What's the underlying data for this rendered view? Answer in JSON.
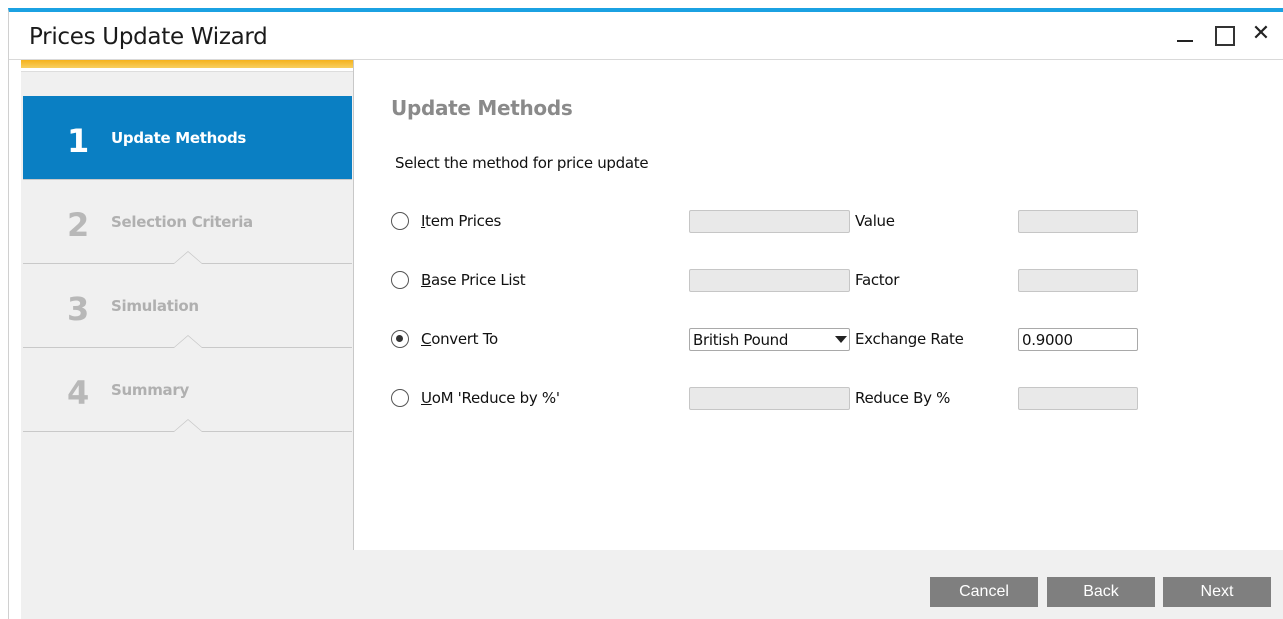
{
  "window": {
    "title": "Prices Update Wizard",
    "accent_color": "#1ba1e2"
  },
  "sidebar": {
    "steps": [
      {
        "number": "1",
        "label": "Update Methods",
        "active": true
      },
      {
        "number": "2",
        "label": "Selection Criteria",
        "active": false
      },
      {
        "number": "3",
        "label": "Simulation",
        "active": false
      },
      {
        "number": "4",
        "label": "Summary",
        "active": false
      }
    ],
    "active_color": "#0a7fc3"
  },
  "main": {
    "section_title": "Update Methods",
    "instruction": "Select the method for price update",
    "methods": [
      {
        "label_first": "I",
        "label_rest": "tem Prices",
        "selected": false,
        "field_value": "",
        "param_label": "Value",
        "param_value": ""
      },
      {
        "label_first": "B",
        "label_rest": "ase Price List",
        "selected": false,
        "field_value": "",
        "param_label": "Factor",
        "param_value": ""
      },
      {
        "label_first": "C",
        "label_rest": "onvert To",
        "selected": true,
        "field_value": "British Pound",
        "param_label": "Exchange Rate",
        "param_value": "0.9000"
      },
      {
        "label_first": "U",
        "label_rest": "oM 'Reduce by %'",
        "selected": false,
        "field_value": "",
        "param_label": "Reduce By %",
        "param_value": ""
      }
    ]
  },
  "footer": {
    "cancel_label": "Cancel",
    "back_label": "Back",
    "next_label": "Next"
  }
}
